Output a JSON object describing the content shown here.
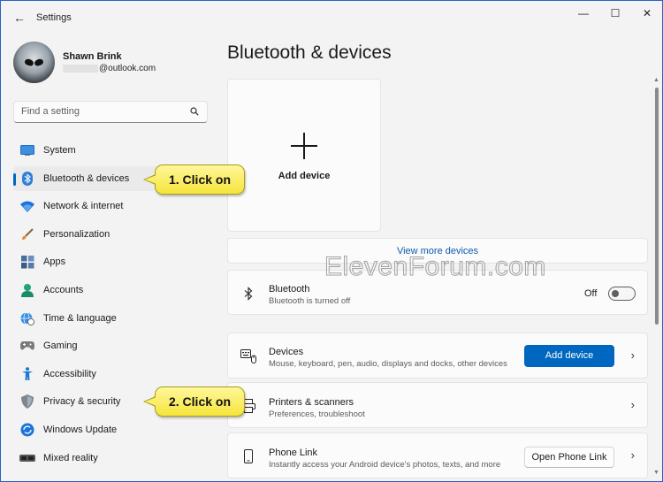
{
  "window": {
    "title": "Settings",
    "controls": {
      "minimize": "—",
      "maximize": "☐",
      "close": "✕"
    }
  },
  "user": {
    "name": "Shawn Brink",
    "email": "@outlook.com"
  },
  "search": {
    "placeholder": "Find a setting",
    "value": ""
  },
  "sidebar": {
    "items": [
      {
        "label": "System",
        "icon": "system-icon",
        "selected": false
      },
      {
        "label": "Bluetooth & devices",
        "icon": "bluetooth-icon",
        "selected": true
      },
      {
        "label": "Network & internet",
        "icon": "wifi-icon",
        "selected": false
      },
      {
        "label": "Personalization",
        "icon": "brush-icon",
        "selected": false
      },
      {
        "label": "Apps",
        "icon": "apps-icon",
        "selected": false
      },
      {
        "label": "Accounts",
        "icon": "accounts-icon",
        "selected": false
      },
      {
        "label": "Time & language",
        "icon": "globe-clock-icon",
        "selected": false
      },
      {
        "label": "Gaming",
        "icon": "gamepad-icon",
        "selected": false
      },
      {
        "label": "Accessibility",
        "icon": "accessibility-icon",
        "selected": false
      },
      {
        "label": "Privacy & security",
        "icon": "shield-icon",
        "selected": false
      },
      {
        "label": "Windows Update",
        "icon": "update-icon",
        "selected": false
      },
      {
        "label": "Mixed reality",
        "icon": "headset-icon",
        "selected": false
      }
    ]
  },
  "main": {
    "title": "Bluetooth & devices",
    "add_device_tile": {
      "label": "Add device"
    },
    "view_more": "View more devices",
    "bluetooth": {
      "title": "Bluetooth",
      "subtitle": "Bluetooth is turned off",
      "toggle_label": "Off",
      "toggle_on": false
    },
    "devices": {
      "title": "Devices",
      "subtitle": "Mouse, keyboard, pen, audio, displays and docks, other devices",
      "button": "Add device"
    },
    "printers": {
      "title": "Printers & scanners",
      "subtitle": "Preferences, troubleshoot"
    },
    "phone_link": {
      "title": "Phone Link",
      "subtitle": "Instantly access your Android device's photos, texts, and more",
      "button": "Open Phone Link"
    }
  },
  "watermark": "ElevenForum.com",
  "callouts": {
    "step1": "1. Click on",
    "step2": "2. Click on"
  },
  "colors": {
    "accent": "#0067c0",
    "window_bg": "#f3f3f3",
    "card_bg": "#fbfbfb",
    "callout_fill": "#f6e53c",
    "link": "#0b5cad"
  }
}
